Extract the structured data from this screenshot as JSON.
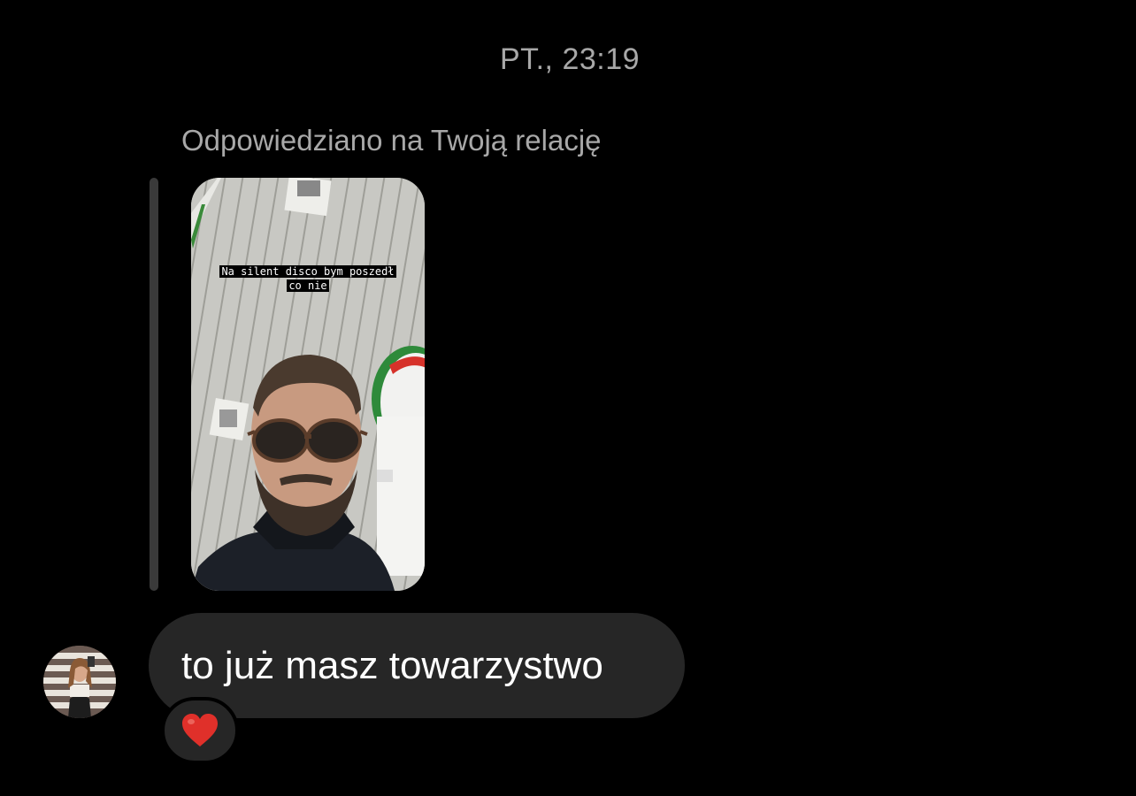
{
  "thread": {
    "timestamp": "PT., 23:19",
    "reply_header": "Odpowiedziano na Twoją relację"
  },
  "story": {
    "caption_line1": "Na silent disco bym poszedł",
    "caption_line2": "co nie"
  },
  "message": {
    "text": "to już masz towarzystwo",
    "reaction": "heart"
  },
  "colors": {
    "background": "#000000",
    "bubble": "#262626",
    "secondary_text": "#a8a8a8",
    "reaction_heart": "#e0302a"
  }
}
